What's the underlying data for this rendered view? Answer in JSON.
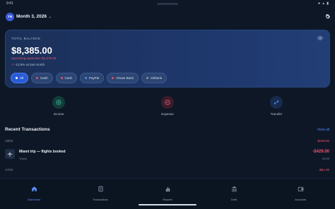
{
  "statusbar": {
    "time": "9:41",
    "right": "● ▴ ▮"
  },
  "header": {
    "avatar_initials": "TN",
    "month": "Month 3, 2026",
    "chevron": "⌄",
    "settings_icon": "gear-icon"
  },
  "balance_card": {
    "label": "TOTAL BALANCE",
    "amount": "$8,385.00",
    "upcoming": "Upcoming expenses: $1,375.00",
    "trend_arrow": "↗",
    "trend_text": "-12.8% vs last month",
    "chips": [
      {
        "label": "All",
        "active": true,
        "color": ""
      },
      {
        "label": "Cash",
        "active": false,
        "color": "#e0566b"
      },
      {
        "label": "Cash",
        "active": false,
        "color": "#e0566b"
      },
      {
        "label": "PayPal",
        "active": false,
        "color": "#4d8af0"
      },
      {
        "label": "Chase Bank",
        "active": false,
        "color": "#e0566b"
      },
      {
        "label": "Citibank",
        "active": false,
        "color": "#8a97ab"
      }
    ]
  },
  "actions": [
    {
      "label": "Income",
      "color": "#1f8f74",
      "bg": "#153a3a"
    },
    {
      "label": "Expense",
      "color": "#e0566b",
      "bg": "#3a1c2a"
    },
    {
      "label": "Transfer",
      "color": "#4d8af0",
      "bg": "#172c4d"
    }
  ],
  "recent": {
    "title": "Recent Transactions",
    "view_all": "View all",
    "groups": [
      {
        "date": "19/03",
        "total": "-$429.00"
      },
      {
        "date": "17/03",
        "total": "-$51.00"
      }
    ],
    "transaction": {
      "title": "Miami trip — flights booked",
      "category": "Travel",
      "amount": "-$429.00",
      "time": "00:00"
    }
  },
  "tabs": [
    {
      "label": "Dashboard",
      "active": true
    },
    {
      "label": "Transactions",
      "active": false
    },
    {
      "label": "Reports",
      "active": false
    },
    {
      "label": "Debt",
      "active": false
    },
    {
      "label": "Accounts",
      "active": false
    }
  ]
}
